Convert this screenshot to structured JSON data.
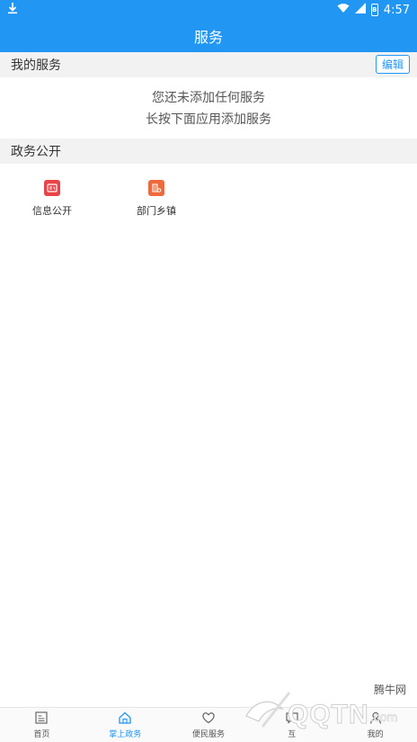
{
  "status_bar": {
    "time": "4:57",
    "battery_glyph": "B"
  },
  "title": "服务",
  "my_services": {
    "header": "我的服务",
    "edit_label": "编辑",
    "empty_line1": "您还未添加任何服务",
    "empty_line2": "长按下面应用添加服务"
  },
  "gov_public": {
    "header": "政务公开",
    "items": [
      {
        "label": "信息公开",
        "icon": "info-public-icon",
        "color": "#e8444a"
      },
      {
        "label": "部门乡镇",
        "icon": "department-town-icon",
        "color": "#ee6a3c"
      }
    ]
  },
  "bottom_nav": [
    {
      "label": "首页",
      "icon": "home-page-icon"
    },
    {
      "label": "掌上政务",
      "icon": "house-icon",
      "active": true
    },
    {
      "label": "便民服务",
      "icon": "heart-icon"
    },
    {
      "label": "互",
      "icon": "chat-icon"
    },
    {
      "label": "我的",
      "icon": "user-icon"
    }
  ],
  "watermark": {
    "text": "QQTN",
    "suffix": ".com",
    "cn": "腾牛网"
  },
  "colors": {
    "primary": "#2196F3",
    "section_bg": "#f2f2f2"
  }
}
